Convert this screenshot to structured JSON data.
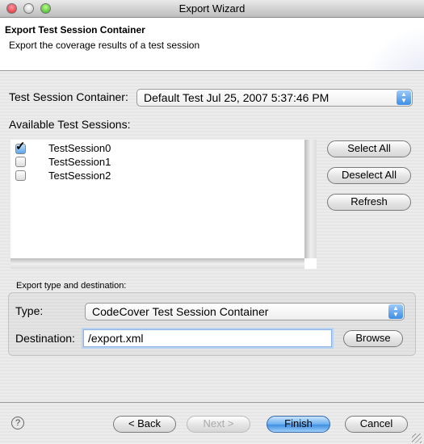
{
  "window": {
    "title": "Export Wizard"
  },
  "header": {
    "title": "Export Test Session Container",
    "description": "Export the coverage results of a test session"
  },
  "container": {
    "label": "Test Session Container:",
    "selected": "Default Test Jul 25, 2007 5:37:46 PM"
  },
  "sessions": {
    "label": "Available Test Sessions:",
    "items": [
      {
        "name": "TestSession0",
        "checked": true
      },
      {
        "name": "TestSession1",
        "checked": false
      },
      {
        "name": "TestSession2",
        "checked": false
      }
    ],
    "select_all": "Select All",
    "deselect_all": "Deselect All",
    "refresh": "Refresh"
  },
  "export": {
    "group_label": "Export type and destination:",
    "type_label": "Type:",
    "type_value": "CodeCover Test Session Container",
    "dest_label": "Destination:",
    "dest_value": "/export.xml",
    "browse": "Browse"
  },
  "footer": {
    "back": "< Back",
    "next": "Next >",
    "finish": "Finish",
    "cancel": "Cancel"
  }
}
